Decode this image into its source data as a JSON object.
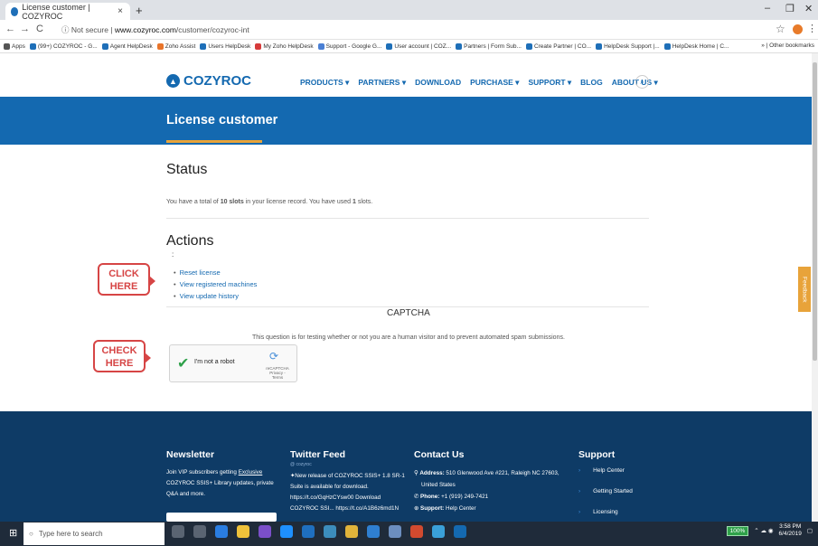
{
  "browser": {
    "tab_title": "License customer | COZYROC",
    "tab_close": "×",
    "new_tab": "+",
    "win_min": "–",
    "win_max": "❐",
    "win_close": "✕",
    "back": "←",
    "forward": "→",
    "reload": "C",
    "security": "ⓘ Not secure",
    "url_host": "www.cozyroc.com",
    "url_path": "/customer/cozyroc-int",
    "star": "☆",
    "menu": "⋮",
    "bookmarks": [
      "Apps",
      "(99+) COZYROC - G...",
      "Agent HelpDesk",
      "Zoho Assist",
      "Users HelpDesk",
      "My Zoho HelpDesk",
      "Support - Google G...",
      "User account | COZ...",
      "Partners | Form Sub...",
      "Create Partner | CO...",
      "HelpDesk Support |...",
      "HelpDesk Home | C..."
    ],
    "bookmarks_more": "»",
    "other_bookmarks": "Other bookmarks"
  },
  "site": {
    "logo": "COZYROC",
    "nav": [
      "PRODUCTS ▾",
      "PARTNERS ▾",
      "DOWNLOAD",
      "PURCHASE ▾",
      "SUPPORT ▾",
      "BLOG",
      "ABOUT US ▾"
    ],
    "search_icon": "⌕"
  },
  "page": {
    "title": "License customer",
    "status_heading": "Status",
    "status_pre": "You have a total of ",
    "status_slots": "10 slots",
    "status_mid": " in your license record. You have used ",
    "status_used": "1",
    "status_post": " slots.",
    "actions_heading": "Actions",
    "actions_dot": ":",
    "actions": [
      "Reset license",
      "View registered machines",
      "View update history"
    ],
    "captcha_title": "CAPTCHA",
    "captcha_desc": "This question is for testing whether or not you are a human visitor and to prevent automated spam submissions.",
    "recaptcha_label": "I'm not a robot",
    "recaptcha_brand": "reCAPTCHA",
    "recaptcha_terms": "Privacy - Terms",
    "callout_click": "CLICK HERE",
    "callout_check": "CHECK HERE",
    "feedback": "Feedback"
  },
  "footer": {
    "newsletter_title": "Newsletter",
    "newsletter_line1_pre": "Join VIP subscribers getting ",
    "newsletter_line1_link": "Exclusive",
    "newsletter_line2": "COZYROC SSIS+ Library updates, private",
    "newsletter_line3": "Q&A and more.",
    "twitter_title": "Twitter Feed",
    "twitter_handle": "@ cozyroc",
    "twitter_lines": [
      "New release of COZYROC SSIS+ 1.8 SR-1",
      "Suite is available for download.",
      "https://t.co/GqHzCYsw00 Download",
      "COZYROC SSI... https://t.co/A1B6z6md1N"
    ],
    "contact_title": "Contact Us",
    "contact_address_label": "Address:",
    "contact_address": " 510 Glenwood Ave #221, Raleigh NC 27603,",
    "contact_address2": "United States",
    "contact_phone_label": "Phone:",
    "contact_phone": " +1 (919) 249-7421",
    "contact_support_label": "Support:",
    "contact_support": " Help Center",
    "support_title": "Support",
    "support_items": [
      "Help Center",
      "Getting Started",
      "Licensing"
    ]
  },
  "taskbar": {
    "search_placeholder": "Type here to search",
    "battery": "100%",
    "time": "3:58 PM",
    "date": "6/4/2019"
  }
}
